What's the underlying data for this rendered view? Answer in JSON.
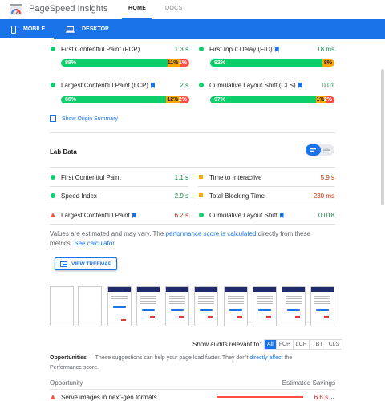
{
  "header": {
    "app_title": "PageSpeed Insights",
    "tabs": [
      "HOME",
      "DOCS"
    ]
  },
  "device_tabs": [
    "MOBILE",
    "DESKTOP"
  ],
  "field_metrics": [
    {
      "label": "First Contentful Paint (FCP)",
      "value": "1.3 s",
      "flag": false,
      "dist": [
        "88%",
        "11%",
        "1%"
      ],
      "fractions": [
        0.88,
        0.11,
        0.01
      ]
    },
    {
      "label": "First Input Delay (FID)",
      "value": "18 ms",
      "flag": true,
      "dist": [
        "92%",
        "8%",
        ""
      ],
      "fractions": [
        0.92,
        0.08,
        0
      ]
    },
    {
      "label": "Largest Contentful Paint (LCP)",
      "value": "2 s",
      "flag": true,
      "dist": [
        "86%",
        "12%",
        "2%"
      ],
      "fractions": [
        0.86,
        0.12,
        0.02
      ]
    },
    {
      "label": "Cumulative Layout Shift (CLS)",
      "value": "0.01",
      "flag": true,
      "dist": [
        "97%",
        "1%",
        "2%"
      ],
      "fractions": [
        0.97,
        0.01,
        0.02
      ]
    }
  ],
  "origin_summary": "Show Origin Summary",
  "lab_title": "Lab Data",
  "lab_metrics": [
    {
      "label": "First Contentful Paint",
      "value": "1.1 s",
      "status": "good"
    },
    {
      "label": "Time to Interactive",
      "value": "5.9 s",
      "status": "average"
    },
    {
      "label": "Speed Index",
      "value": "2.9 s",
      "status": "good"
    },
    {
      "label": "Total Blocking Time",
      "value": "230 ms",
      "status": "average"
    },
    {
      "label": "Largest Contentful Paint",
      "value": "6.2 s",
      "status": "poor",
      "flag": true
    },
    {
      "label": "Cumulative Layout Shift",
      "value": "0.018",
      "status": "good",
      "flag": true
    }
  ],
  "disclaimer": {
    "prefix": "Values are estimated and may vary. The ",
    "link1": "performance score is calculated",
    "middle": " directly from these metrics. ",
    "link2": "See calculator."
  },
  "treemap_button": "VIEW TREEMAP",
  "audits": {
    "label": "Show audits relevant to:",
    "filters": [
      "All",
      "FCP",
      "LCP",
      "TBT",
      "CLS"
    ]
  },
  "opportunities": {
    "title": "Opportunities",
    "desc_prefix": " — These suggestions can help your page load faster. They don't ",
    "desc_link": "directly affect",
    "desc_suffix": " the Performance score.",
    "col_left": "Opportunity",
    "col_right": "Estimated Savings",
    "first_item": "Serve images in next-gen formats",
    "first_value": "6.6 s"
  },
  "colors": {
    "accent": "#1a73e8",
    "good": "#0cce6b",
    "average": "#ffa400",
    "poor": "#ff4e42"
  }
}
